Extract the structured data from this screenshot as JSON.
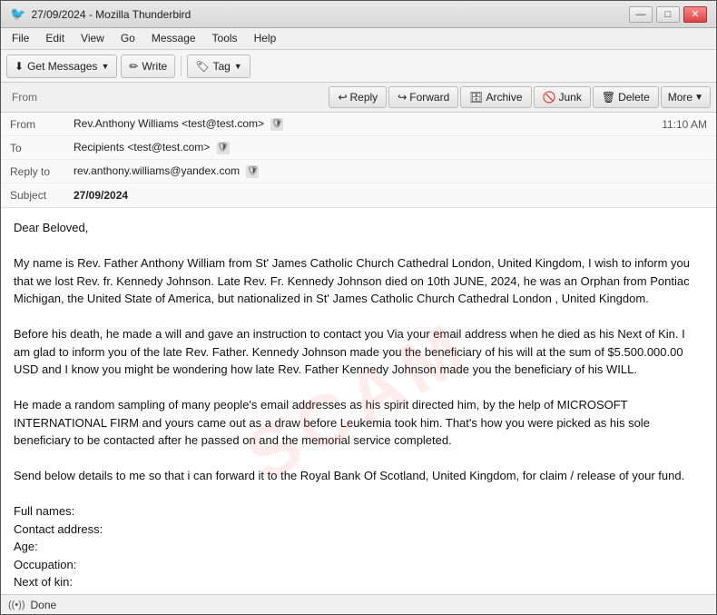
{
  "window": {
    "title": "27/09/2024 - Mozilla Thunderbird",
    "app_icon": "🐦"
  },
  "menu": {
    "items": [
      "File",
      "Edit",
      "View",
      "Go",
      "Message",
      "Tools",
      "Help"
    ]
  },
  "toolbar": {
    "get_messages_label": "Get Messages",
    "write_label": "Write",
    "tag_label": "Tag"
  },
  "action_buttons": {
    "reply_label": "Reply",
    "forward_label": "Forward",
    "archive_label": "Archive",
    "junk_label": "Junk",
    "delete_label": "Delete",
    "more_label": "More"
  },
  "email": {
    "from_label": "From",
    "to_label": "To",
    "reply_to_label": "Reply to",
    "subject_label": "Subject",
    "from_value": "Rev.Anthony Williams <test@test.com>",
    "to_value": "Recipients <test@test.com>",
    "reply_to_value": "rev.anthony.williams@yandex.com",
    "subject_value": "27/09/2024",
    "time": "11:10 AM",
    "body": "Dear Beloved,\n\nMy name is Rev. Father Anthony William from St' James Catholic Church Cathedral London, United Kingdom, I wish to inform you that we lost Rev. fr. Kennedy Johnson. Late Rev. Fr. Kennedy Johnson died on 10th JUNE, 2024, he was an Orphan from Pontiac Michigan, the United State of America, but nationalized in  St' James Catholic Church Cathedral London  , United Kingdom.\n\nBefore his death, he made a will and gave an instruction to contact you Via your email address when he died as his Next of Kin. I am glad to inform you of the late Rev. Father.  Kennedy Johnson made you the beneficiary of his will at the sum of $5.500.000.00 USD and I know you might be wondering how late Rev. Father Kennedy Johnson made you the beneficiary of his WILL.\n\nHe made a random sampling of many people's email addresses as his spirit directed him, by the help of MICROSOFT INTERNATIONAL FIRM and yours came out as a draw before Leukemia took him. That's how you were picked as his sole beneficiary to be contacted after he passed on and the memorial service completed.\n\nSend below details to me so that i can forward it to the Royal Bank Of Scotland, United Kingdom, for claim / release of your fund.\n\nFull names:\nContact address:\nAge:\nOccupation:\nNext of kin:\nValid ID:\nprivate phone number:\n\nThank you & remain blessed,\nRev. Father. Anthony Williams"
  },
  "statusbar": {
    "icon": "((•))",
    "text": "Done"
  }
}
